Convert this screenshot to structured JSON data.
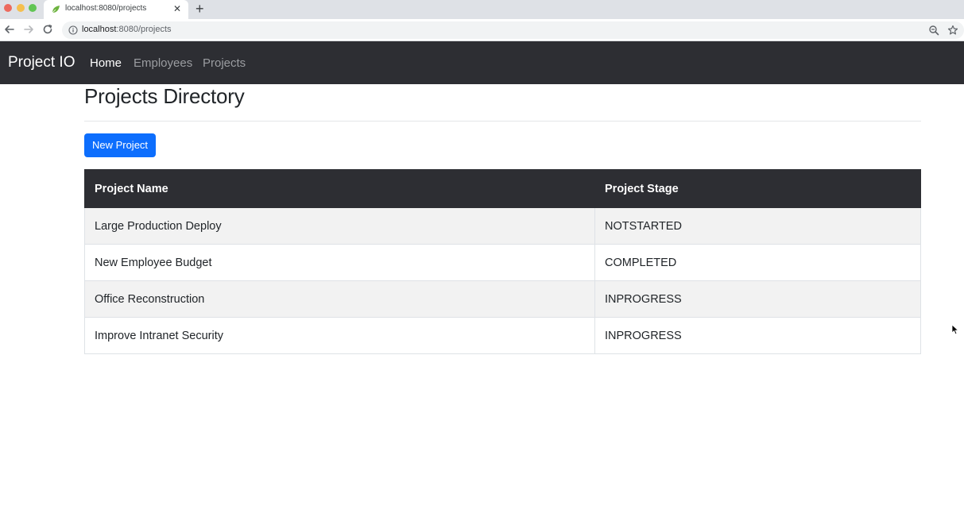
{
  "browser": {
    "tab_title": "localhost:8080/projects",
    "tab_close": "✕",
    "new_tab": "+",
    "url_host": "localhost",
    "url_rest": ":8080/projects"
  },
  "navbar": {
    "brand": "Project IO",
    "links": [
      {
        "label": "Home",
        "active": true
      },
      {
        "label": "Employees",
        "active": false
      },
      {
        "label": "Projects",
        "active": false
      }
    ]
  },
  "main": {
    "title": "Projects Directory",
    "new_button_label": "New Project",
    "table": {
      "headers": [
        "Project Name",
        "Project Stage"
      ],
      "rows": [
        {
          "name": "Large Production Deploy",
          "stage": "NOTSTARTED"
        },
        {
          "name": "New Employee Budget",
          "stage": "COMPLETED"
        },
        {
          "name": "Office Reconstruction",
          "stage": "INPROGRESS"
        },
        {
          "name": "Improve Intranet Security",
          "stage": "INPROGRESS"
        }
      ]
    }
  },
  "colors": {
    "navbar_bg": "#2d2e33",
    "primary_button": "#0d6efd",
    "table_header_bg": "#2d2e33",
    "striped_row_bg": "#f2f2f2"
  }
}
